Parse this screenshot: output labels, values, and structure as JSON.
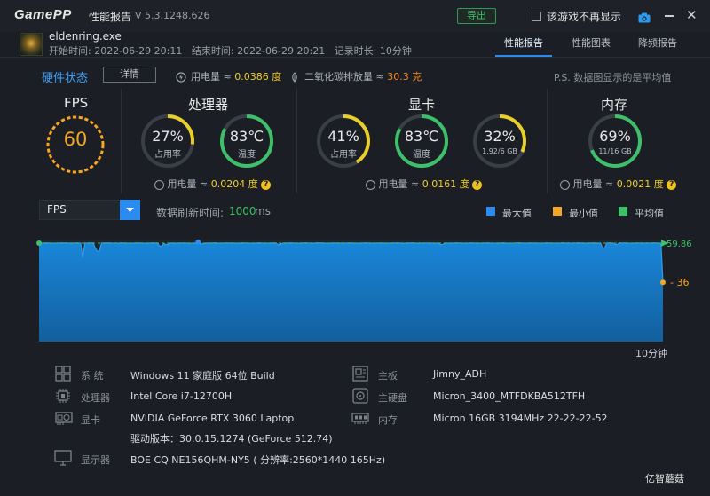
{
  "titlebar": {
    "logo": "GamePP",
    "app_title": "性能报告",
    "version": "V 5.3.1248.626",
    "export_label": "导出",
    "dont_show_label": "该游戏不再显示",
    "camera_icon": "camera-icon",
    "minimize_icon": "minimize-icon",
    "close_icon": "close-icon",
    "close_glyph": "✕"
  },
  "header": {
    "game_name": "eldenring.exe",
    "start_label": "开始时间:",
    "start_time": "2022-06-29 20:11",
    "end_label": "结束时间:",
    "end_time": "2022-06-29 20:21",
    "duration_label": "记录时长:",
    "duration": "10分钟",
    "tabs": [
      "性能报告",
      "性能图表",
      "降频报告"
    ],
    "active_tab": 0
  },
  "hardware": {
    "title": "硬件状态",
    "detail_label": "详情",
    "power_label": "用电量 ≈",
    "power_total": "0.0386 度",
    "co2_label": "二氧化碳排放量 ≈",
    "co2_value": "30.3 克",
    "note": "P.S. 数据图显示的是平均值",
    "fps": {
      "title": "FPS",
      "value": "60"
    },
    "cpu": {
      "title": "处理器",
      "usage": "27%",
      "usage_label": "占用率",
      "usage_fraction": 0.27,
      "temp": "83℃",
      "temp_label": "温度",
      "temp_fraction": 0.83,
      "power_label": "用电量 ≈",
      "power": "0.0204 度"
    },
    "gpu": {
      "title": "显卡",
      "usage": "41%",
      "usage_label": "占用率",
      "usage_fraction": 0.41,
      "temp": "83℃",
      "temp_label": "温度",
      "temp_fraction": 0.83,
      "vram": "32%",
      "vram_label": "1.92/6 GB",
      "vram_fraction": 0.32,
      "power_label": "用电量 ≈",
      "power": "0.0161 度"
    },
    "memory": {
      "title": "内存",
      "usage": "69%",
      "usage_label": "11/16 GB",
      "usage_fraction": 0.69,
      "power_label": "用电量 ≈",
      "power": "0.0021 度"
    },
    "colors": {
      "ring_yellow": "#e8cf2a",
      "ring_green": "#3ec06a",
      "ring_track": "#3a3e45",
      "fps_orange": "#f5a623"
    }
  },
  "chart_controls": {
    "metric": "FPS",
    "refresh_label": "数据刷新时间:",
    "refresh_value": "1000",
    "refresh_unit": "ms",
    "legend": [
      {
        "label": "最大值",
        "color": "#2a8cf0"
      },
      {
        "label": "最小值",
        "color": "#f5a623"
      },
      {
        "label": "平均值",
        "color": "#3ec06a"
      }
    ]
  },
  "chart_data": {
    "type": "area",
    "series": [
      {
        "name": "FPS",
        "color": "#1e7fd0"
      }
    ],
    "x_end_label": "10分钟",
    "avg_value": 59.86,
    "avg_label": "59.86",
    "min_value": 36,
    "min_label": "36",
    "typical_value": 60,
    "dips": [
      {
        "t": 0.07,
        "y": 51
      },
      {
        "t": 0.09,
        "y": 57
      },
      {
        "t": 0.095,
        "y": 55
      },
      {
        "t": 0.195,
        "y": 58
      },
      {
        "t": 0.205,
        "y": 59
      },
      {
        "t": 0.26,
        "y": 59
      },
      {
        "t": 0.385,
        "y": 59
      },
      {
        "t": 0.645,
        "y": 59
      },
      {
        "t": 0.905,
        "y": 57
      },
      {
        "t": 0.925,
        "y": 59
      },
      {
        "t": 1.0,
        "y": 36
      }
    ],
    "ylim": [
      0,
      62
    ]
  },
  "system_info": [
    {
      "icon": "windows-icon",
      "key": "系   统",
      "value": "Windows 11 家庭版 64位  Build"
    },
    {
      "icon": "motherboard-icon",
      "key": "主板",
      "value": "Jimny_ADH"
    },
    {
      "icon": "cpu-icon",
      "key": "处理器",
      "value": "Intel Core i7-12700H"
    },
    {
      "icon": "disk-icon",
      "key": "主硬盘",
      "value": "Micron_3400_MTFDKBA512TFH"
    },
    {
      "icon": "gpu-icon",
      "key": "显卡",
      "value": "NVIDIA GeForce RTX 3060 Laptop"
    },
    {
      "icon": "memory-icon",
      "key": "内存",
      "value": "Micron 16GB 3194MHz 22-22-22-52"
    },
    {
      "icon": "driver-icon",
      "key": "",
      "value": "驱动版本：30.0.15.1274 (GeForce 512.74)"
    },
    {
      "icon": "monitor-icon",
      "key": "显示器",
      "value": "BOE CQ NE156QHM-NY5 ( 分辨率:2560*1440 165Hz)"
    }
  ],
  "watermark": "亿智蘑菇"
}
